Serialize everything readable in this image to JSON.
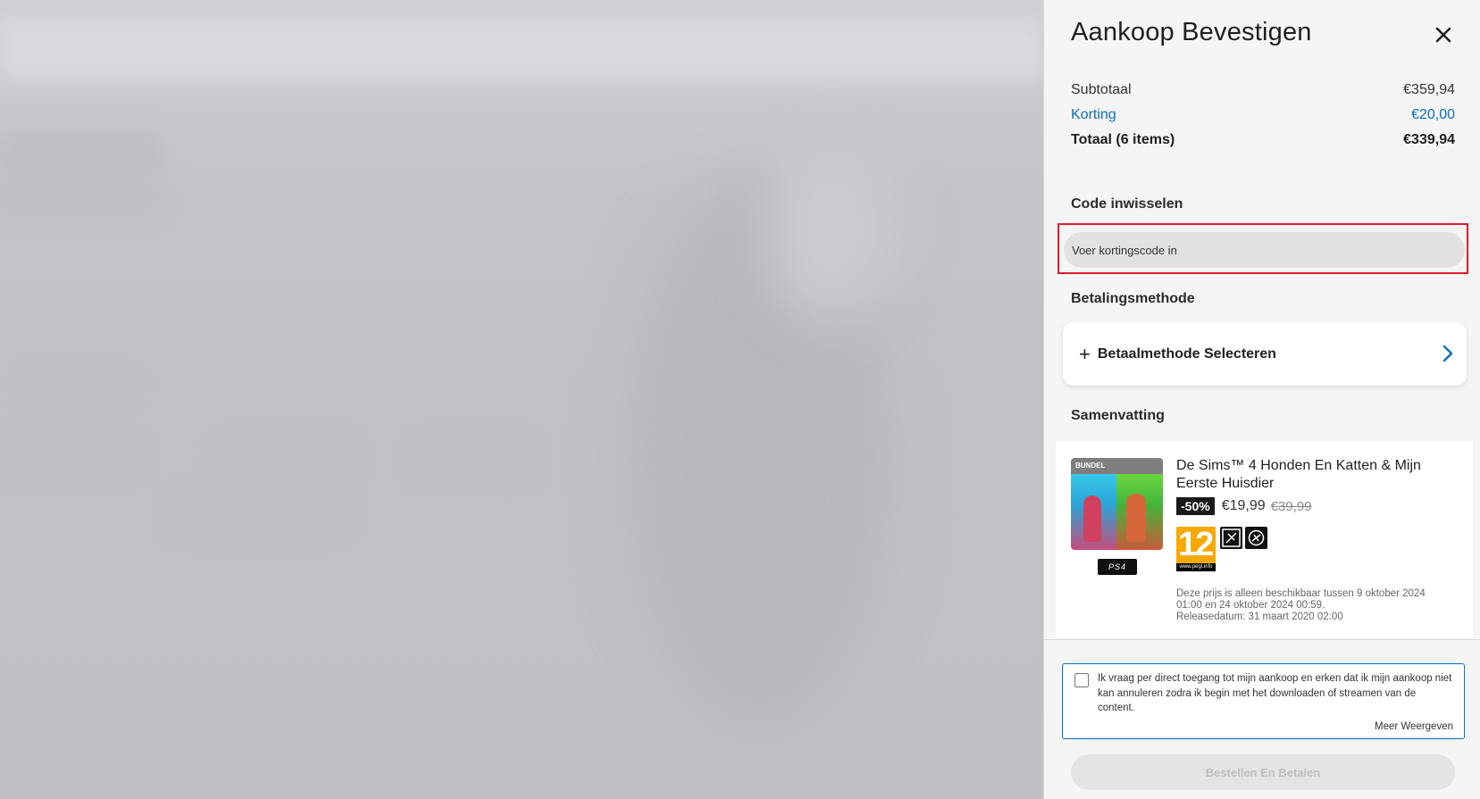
{
  "checkout": {
    "title": "Aankoop Bevestigen",
    "subtotal_label": "Subtotaal",
    "subtotal_value": "€359,94",
    "discount_label": "Korting",
    "discount_value": "€20,00",
    "total_label": "Totaal (6 items)",
    "total_value": "€339,94"
  },
  "redeem": {
    "heading": "Code inwisselen",
    "placeholder": "Voer kortingscode in"
  },
  "payment": {
    "heading": "Betalingsmethode",
    "select_label": "Betaalmethode Selecteren"
  },
  "summary": {
    "heading": "Samenvatting",
    "item": {
      "cover_label": "BUNDEL",
      "platform": "PS4",
      "title": "De Sims™ 4 Honden En Katten & Mijn Eerste Huisdier",
      "discount_badge": "-50%",
      "price": "€19,99",
      "original_price": "€39,99",
      "pegi_rating": "12",
      "pegi_site": "www.pegi.info",
      "notice_line1": "Deze prijs is alleen beschikbaar tussen 9 oktober 2024 01:00 en 24 oktober 2024 00:59.",
      "notice_line2": "Releasedatum: 31 maart 2020 02:00"
    }
  },
  "consent": {
    "text": "Ik vraag per direct toegang tot mijn aankoop en erken dat ik mijn aankoop niet kan annuleren zodra ik begin met het downloaden of streamen van de content.",
    "more_label": "Meer Weergeven"
  },
  "actions": {
    "buy_label": "Bestellen En Betalen"
  },
  "colors": {
    "accent_blue": "#0a6fc2",
    "highlight_red": "#e01b2a",
    "pegi_orange": "#f7a800"
  }
}
